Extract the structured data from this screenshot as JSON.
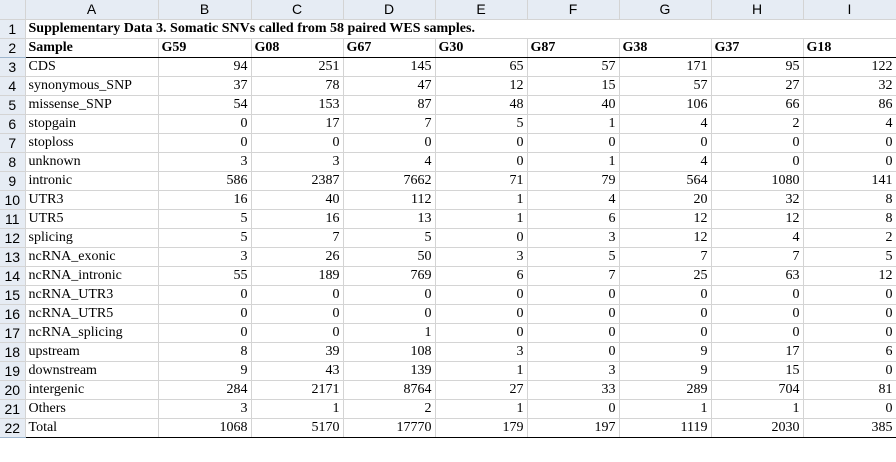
{
  "columns": [
    "A",
    "B",
    "C",
    "D",
    "E",
    "F",
    "G",
    "H",
    "I"
  ],
  "title": "Supplementary Data 3. Somatic SNVs called from 58 paired WES samples.",
  "header": [
    "Sample",
    "G59",
    "G08",
    "G67",
    "G30",
    "G87",
    "G38",
    "G37",
    "G18"
  ],
  "rows": [
    [
      "CDS",
      "94",
      "251",
      "145",
      "65",
      "57",
      "171",
      "95",
      "122"
    ],
    [
      "synonymous_SNP",
      "37",
      "78",
      "47",
      "12",
      "15",
      "57",
      "27",
      "32"
    ],
    [
      "missense_SNP",
      "54",
      "153",
      "87",
      "48",
      "40",
      "106",
      "66",
      "86"
    ],
    [
      "stopgain",
      "0",
      "17",
      "7",
      "5",
      "1",
      "4",
      "2",
      "4"
    ],
    [
      "stoploss",
      "0",
      "0",
      "0",
      "0",
      "0",
      "0",
      "0",
      "0"
    ],
    [
      "unknown",
      "3",
      "3",
      "4",
      "0",
      "1",
      "4",
      "0",
      "0"
    ],
    [
      "intronic",
      "586",
      "2387",
      "7662",
      "71",
      "79",
      "564",
      "1080",
      "141"
    ],
    [
      "UTR3",
      "16",
      "40",
      "112",
      "1",
      "4",
      "20",
      "32",
      "8"
    ],
    [
      "UTR5",
      "5",
      "16",
      "13",
      "1",
      "6",
      "12",
      "12",
      "8"
    ],
    [
      "splicing",
      "5",
      "7",
      "5",
      "0",
      "3",
      "12",
      "4",
      "2"
    ],
    [
      "ncRNA_exonic",
      "3",
      "26",
      "50",
      "3",
      "5",
      "7",
      "7",
      "5"
    ],
    [
      "ncRNA_intronic",
      "55",
      "189",
      "769",
      "6",
      "7",
      "25",
      "63",
      "12"
    ],
    [
      "ncRNA_UTR3",
      "0",
      "0",
      "0",
      "0",
      "0",
      "0",
      "0",
      "0"
    ],
    [
      "ncRNA_UTR5",
      "0",
      "0",
      "0",
      "0",
      "0",
      "0",
      "0",
      "0"
    ],
    [
      "ncRNA_splicing",
      "0",
      "0",
      "1",
      "0",
      "0",
      "0",
      "0",
      "0"
    ],
    [
      "upstream",
      "8",
      "39",
      "108",
      "3",
      "0",
      "9",
      "17",
      "6"
    ],
    [
      "downstream",
      "9",
      "43",
      "139",
      "1",
      "3",
      "9",
      "15",
      "0"
    ],
    [
      "intergenic",
      "284",
      "2171",
      "8764",
      "27",
      "33",
      "289",
      "704",
      "81"
    ],
    [
      "Others",
      "3",
      "1",
      "2",
      "1",
      "0",
      "1",
      "1",
      "0"
    ],
    [
      "Total",
      "1068",
      "5170",
      "17770",
      "179",
      "197",
      "1119",
      "2030",
      "385"
    ]
  ]
}
